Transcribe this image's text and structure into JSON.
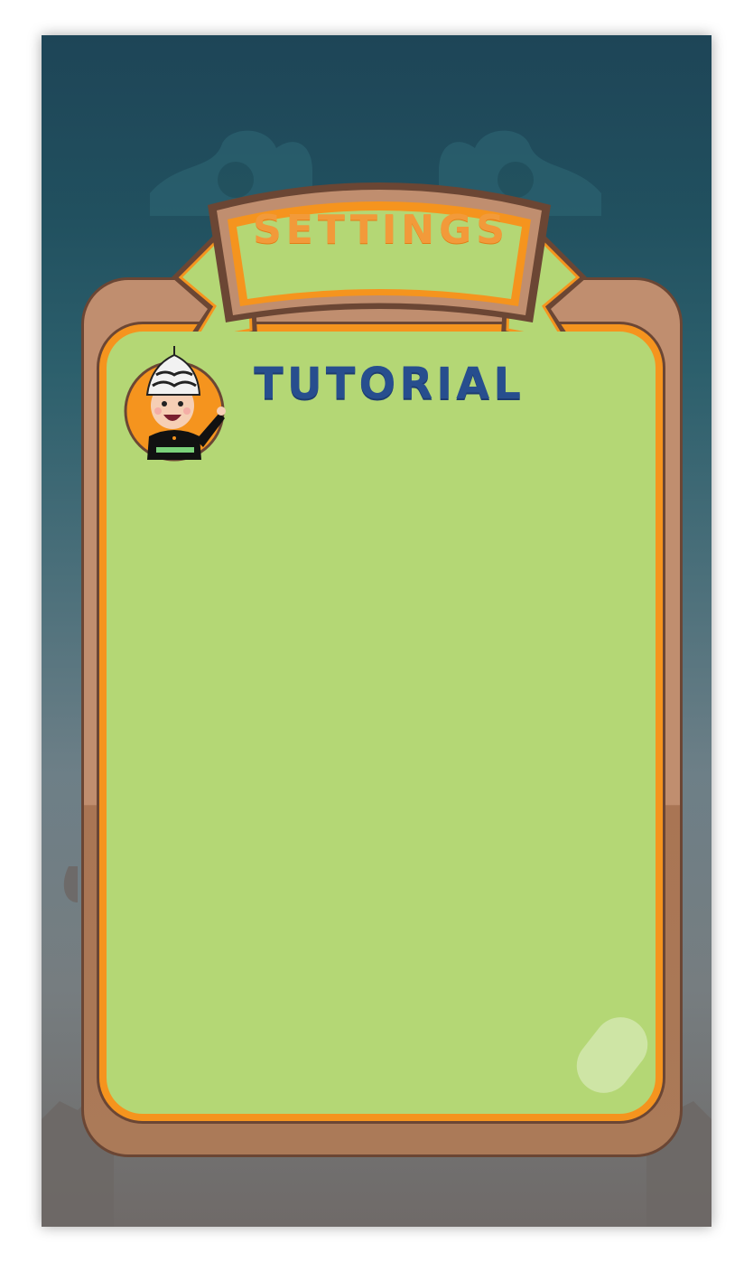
{
  "header": {
    "title": "SETTINGS"
  },
  "panel": {
    "title": "TUTORIAL"
  },
  "icons": {
    "avatar": "character-avatar-icon"
  },
  "colors": {
    "background_top": "#1e4557",
    "background_bottom": "#6f6a68",
    "board": "#c08e6f",
    "board_border": "#6b4634",
    "panel_fill": "#b4d775",
    "panel_border": "#f5941e",
    "settings_text": "#f29a3a",
    "tutorial_text": "#274e8e"
  }
}
